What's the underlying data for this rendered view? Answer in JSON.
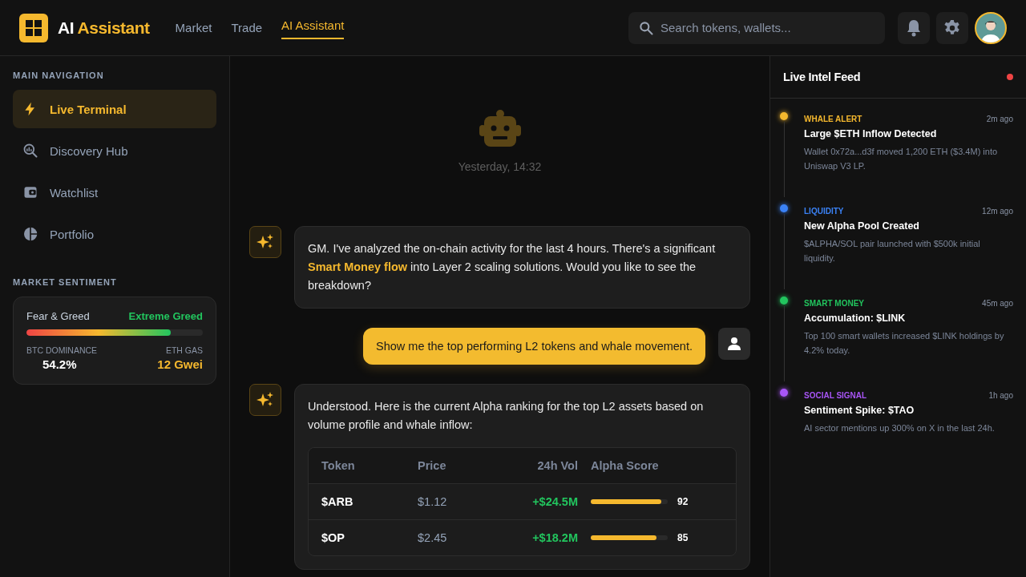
{
  "header": {
    "logo_text": "AI",
    "logo_accent": "Assistant",
    "nav": [
      {
        "label": "Market",
        "selected": false
      },
      {
        "label": "Trade",
        "selected": false
      },
      {
        "label": "AI Assistant",
        "selected": true
      }
    ],
    "search": {
      "placeholder": "Search tokens, wallets..."
    }
  },
  "sidebar": {
    "nav_heading": "MAIN NAVIGATION",
    "items": [
      {
        "label": "Live Terminal",
        "selected": true
      },
      {
        "label": "Discovery Hub",
        "selected": false
      },
      {
        "label": "Watchlist",
        "selected": false
      },
      {
        "label": "Portfolio",
        "selected": false
      }
    ],
    "sentiment_heading": "MARKET SENTIMENT",
    "sentiment": {
      "label": "Fear & Greed",
      "reading": "Extreme Greed",
      "level": 0.82,
      "stats": [
        {
          "label": "BTC DOMINANCE",
          "value": "54.2%",
          "kind": "plain"
        },
        {
          "label": "ETH GAS",
          "value": "12 Gwei",
          "kind": "accent"
        }
      ]
    }
  },
  "chat": {
    "timestamp": "Yesterday, 14:32",
    "messages": [
      {
        "kind": "assistant",
        "text": "GM. I've analyzed the on-chain activity for the last 4 hours. There's a significant **Smart Money flow** into Layer 2 scaling solutions. Would you like to see the breakdown?"
      },
      {
        "kind": "user",
        "text": "Show me the top performing L2 tokens and whale movement."
      },
      {
        "kind": "assistant",
        "text": "Understood. Here is the current Alpha ranking for the top L2 assets based on volume profile and whale inflow:",
        "table": {
          "columns": [
            "Token",
            "Price",
            "24h Vol",
            "Alpha Score"
          ],
          "rows": [
            {
              "token": "$ARB",
              "price": "$1.12",
              "volume": "+$24.5M",
              "level": 0.92,
              "score": "92"
            },
            {
              "token": "$OP",
              "price": "$2.45",
              "volume": "+$18.2M",
              "level": 0.85,
              "score": "85"
            }
          ]
        }
      }
    ]
  },
  "feed": {
    "title": "Live Intel Feed",
    "live": true,
    "items": [
      {
        "tag": "WHALE ALERT",
        "color": "#f5b82e",
        "time": "2m ago",
        "title": "Large $ETH Inflow Detected",
        "text": "Wallet 0x72a...d3f moved 1,200 ETH ($3.4M) into Uniswap V3 LP."
      },
      {
        "tag": "LIQUIDITY",
        "color": "#3b82f6",
        "time": "12m ago",
        "title": "New Alpha Pool Created",
        "text": "$ALPHA/SOL pair launched with $500k initial liquidity."
      },
      {
        "tag": "SMART MONEY",
        "color": "#22c55e",
        "time": "45m ago",
        "title": "Accumulation: $LINK",
        "text": "Top 100 smart wallets increased $LINK holdings by 4.2% today."
      },
      {
        "tag": "SOCIAL SIGNAL",
        "color": "#a855f7",
        "time": "1h ago",
        "title": "Sentiment Spike: $TAO",
        "text": "AI sector mentions up 300% on X in the last 24h."
      }
    ]
  }
}
